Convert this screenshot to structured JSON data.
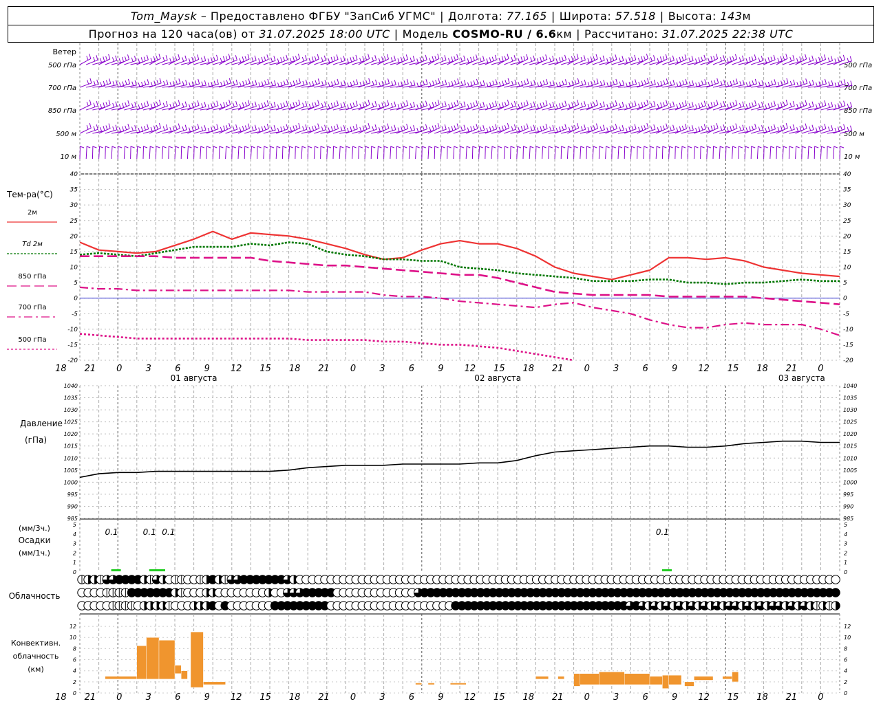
{
  "header": {
    "station": "Tom_Maysk",
    "provider": "– Предоставлено ФГБУ \"ЗапСиб УГМС\"",
    "lon_label": "Долгота:",
    "lon": "77.165",
    "lat_label": "Широта:",
    "lat": "57.518",
    "alt_label": "Высота:",
    "alt": "143",
    "alt_unit": "м",
    "forecast_prefix": "Прогноз на 120 часа(ов) от",
    "forecast_time": "31.07.2025 18:00 UTC",
    "model_label": "Модель",
    "model": "COSMO-RU / 6.6",
    "model_unit": "км",
    "calc_label": "Рассчитано:",
    "calc_time": "31.07.2025 22:38 UTC"
  },
  "chart_data": {
    "type": "line",
    "hour_ticks": [
      "18",
      "21",
      "0",
      "3",
      "6",
      "9",
      "12",
      "15",
      "18",
      "21",
      "0",
      "3",
      "6",
      "9",
      "12",
      "15",
      "18",
      "21",
      "0",
      "3",
      "6",
      "9",
      "12",
      "15",
      "18",
      "21",
      "0"
    ],
    "date_labels": [
      "01 августа",
      "02 августа",
      "03 августа"
    ],
    "wind": {
      "title": "Ветер",
      "levels": [
        "500 гПа",
        "700 гПа",
        "850 гПа",
        "500 м",
        "10 м"
      ],
      "color": "#8800cc"
    },
    "temperature": {
      "title": "Тем-ра(°C)",
      "ylim": [
        -20,
        40
      ],
      "yticks": [
        "40",
        "35",
        "30",
        "25",
        "20",
        "15",
        "10",
        "5",
        "0",
        "-5",
        "-10",
        "-15",
        "-20"
      ],
      "series": [
        {
          "name": "2м",
          "color": "#ee3333",
          "values": [
            18,
            15.5,
            15,
            14.5,
            15,
            17,
            19,
            21.5,
            19,
            21,
            20.5,
            20,
            19,
            17.5,
            16,
            14,
            12.5,
            13,
            15.5,
            17.5,
            18.5,
            17.5,
            17.5,
            16,
            13.5,
            10,
            8,
            7,
            6,
            7.5,
            9,
            13,
            13,
            12.5,
            13,
            12,
            10,
            9,
            8,
            7.5,
            7
          ]
        },
        {
          "name": "Td 2м",
          "color": "#007700",
          "values": [
            14,
            14.5,
            14,
            13.5,
            14.5,
            15.5,
            16.5,
            16.5,
            16.5,
            17.5,
            17,
            18,
            17.5,
            15,
            14,
            13.5,
            12.5,
            12.5,
            12,
            12,
            10,
            9.5,
            9,
            8,
            7.5,
            7,
            6.5,
            5.5,
            5.5,
            5.5,
            6,
            6,
            5,
            5,
            4.5,
            5,
            5,
            5.5,
            6,
            5.5,
            5.5
          ]
        },
        {
          "name": "850 гПа",
          "color": "#dd1188",
          "values": [
            13.5,
            13.5,
            13.5,
            13.5,
            13.5,
            13,
            13,
            13,
            13,
            13,
            12,
            11.5,
            11,
            10.5,
            10.5,
            10,
            9.5,
            9,
            8.5,
            8,
            7.5,
            7.5,
            6.5,
            5,
            3.5,
            2,
            1.5,
            1,
            1,
            1,
            1,
            0.5,
            0.5,
            0.5,
            0.5,
            0.5,
            0,
            -0.5,
            -1,
            -1.5,
            -2
          ]
        },
        {
          "name": "700 гПа",
          "color": "#dd1188",
          "values": [
            3.5,
            3,
            3,
            2.5,
            2.5,
            2.5,
            2.5,
            2.5,
            2.5,
            2.5,
            2.5,
            2.5,
            2,
            2,
            2,
            2,
            1,
            0.5,
            0.5,
            0,
            -1,
            -1.5,
            -2,
            -2.5,
            -3,
            -2,
            -1.5,
            -3,
            -4,
            -5,
            -7,
            -8.5,
            -9.5,
            -9.5,
            -8.5,
            -8,
            -8.5,
            -8.5,
            -8.5,
            -10,
            -12
          ]
        },
        {
          "name": "500 гПа",
          "color": "#dd1188",
          "values": [
            -11.5,
            -12,
            -12.5,
            -13,
            -13,
            -13,
            -13,
            -13,
            -13,
            -13,
            -13,
            -13,
            -13.5,
            -13.5,
            -13.5,
            -13.5,
            -14,
            -14,
            -14.5,
            -15,
            -15,
            -15.5,
            -16,
            -17,
            -18,
            -19,
            -20,
            null,
            null,
            null,
            null,
            null,
            null,
            null,
            null,
            null,
            null,
            null,
            null,
            null,
            null
          ]
        }
      ]
    },
    "pressure": {
      "title": "Давление",
      "unit": "(гПа)",
      "ylim": [
        985,
        1040
      ],
      "yticks": [
        "1040",
        "1035",
        "1030",
        "1025",
        "1020",
        "1015",
        "1010",
        "1005",
        "1000",
        "995",
        "990",
        "985"
      ],
      "values": [
        1002,
        1003.5,
        1004,
        1004,
        1004.5,
        1004.5,
        1004.5,
        1004.5,
        1004.5,
        1004.5,
        1004.5,
        1005,
        1006,
        1006.5,
        1007,
        1007,
        1007,
        1007.5,
        1007.5,
        1007.5,
        1007.5,
        1008,
        1008,
        1009,
        1011,
        1012.5,
        1013,
        1013.5,
        1014,
        1014.5,
        1015,
        1015,
        1014.5,
        1014.5,
        1015,
        1016,
        1016.5,
        1017,
        1017,
        1016.5,
        1016.5
      ]
    },
    "precip": {
      "title": "Осадки",
      "unit_3h": "(мм/3ч.)",
      "unit_1h": "(мм/1ч.)",
      "yticks": [
        "5",
        "4",
        "3",
        "2",
        "1",
        "0"
      ],
      "labels": [
        {
          "hour": 6,
          "text": "0.1"
        },
        {
          "hour": 12,
          "text": "0.1"
        },
        {
          "hour": 15,
          "text": "0.1"
        },
        {
          "hour": 93,
          "text": "0.1"
        }
      ],
      "bars": [
        {
          "hour": 5.5,
          "value": 0.1
        },
        {
          "hour": 11.5,
          "value": 0.1
        },
        {
          "hour": 12.5,
          "value": 0.1
        },
        {
          "hour": 92.5,
          "value": 0.1
        }
      ]
    },
    "cloud": {
      "title": "Облачность",
      "rows": [
        "12213344442132011001242133444444432000000000000000000000000000000000000000000000000000000000000000000000000000000000000000",
        "00001111444444421000220000000020033344444000000000000034444444444444444444444444444444444444444444444444444444444444444444",
        "00000111102222100022240400000004444444440000000000000000000044444444444444444444444444443432323232323232332323233232321212"
      ]
    },
    "convective": {
      "title": "Конвективн.",
      "title2": "облачность",
      "unit": "(км)",
      "ylim": [
        0,
        13
      ],
      "yticks": [
        "12",
        "10",
        "8",
        "6",
        "4",
        "2",
        "0"
      ],
      "bars": [
        {
          "h0": 4,
          "h1": 9,
          "base": 2.5,
          "top": 3
        },
        {
          "h0": 9,
          "h1": 10.5,
          "base": 2.5,
          "top": 8.5
        },
        {
          "h0": 10.5,
          "h1": 12.5,
          "base": 2.5,
          "top": 10
        },
        {
          "h0": 12.5,
          "h1": 15,
          "base": 2.5,
          "top": 9.5
        },
        {
          "h0": 15,
          "h1": 16,
          "base": 3.5,
          "top": 5
        },
        {
          "h0": 16,
          "h1": 17,
          "base": 2.5,
          "top": 4
        },
        {
          "h0": 17.5,
          "h1": 19.5,
          "base": 1,
          "top": 11
        },
        {
          "h0": 19.5,
          "h1": 23,
          "base": 1.5,
          "top": 2
        },
        {
          "h0": 53,
          "h1": 54,
          "base": 1.5,
          "top": 1.8
        },
        {
          "h0": 55,
          "h1": 56,
          "base": 1.5,
          "top": 1.8
        },
        {
          "h0": 58.5,
          "h1": 61,
          "base": 1.5,
          "top": 1.8
        },
        {
          "h0": 72,
          "h1": 74,
          "base": 2.5,
          "top": 3
        },
        {
          "h0": 75.5,
          "h1": 76.5,
          "base": 2.5,
          "top": 3
        },
        {
          "h0": 78,
          "h1": 79,
          "base": 1.2,
          "top": 3.5
        },
        {
          "h0": 79,
          "h1": 82,
          "base": 1.5,
          "top": 3.5
        },
        {
          "h0": 82,
          "h1": 86,
          "base": 1.5,
          "top": 3.8
        },
        {
          "h0": 86,
          "h1": 90,
          "base": 1.5,
          "top": 3.5
        },
        {
          "h0": 90,
          "h1": 92,
          "base": 1.5,
          "top": 3
        },
        {
          "h0": 92,
          "h1": 93,
          "base": 0.8,
          "top": 3.2
        },
        {
          "h0": 93,
          "h1": 95,
          "base": 1.5,
          "top": 3.2
        },
        {
          "h0": 95.5,
          "h1": 97,
          "base": 1.2,
          "top": 2
        },
        {
          "h0": 97,
          "h1": 100,
          "base": 2.3,
          "top": 3
        },
        {
          "h0": 101.5,
          "h1": 103,
          "base": 2.5,
          "top": 3
        },
        {
          "h0": 103,
          "h1": 104,
          "base": 2,
          "top": 3.8
        }
      ]
    }
  },
  "colors": {
    "temp2m": "#ee3333",
    "td": "#007700",
    "upper": "#dd1188",
    "precip": "#22cc22",
    "conv": "#f0952e",
    "wind": "#8800cc",
    "zero": "#2222cc"
  }
}
